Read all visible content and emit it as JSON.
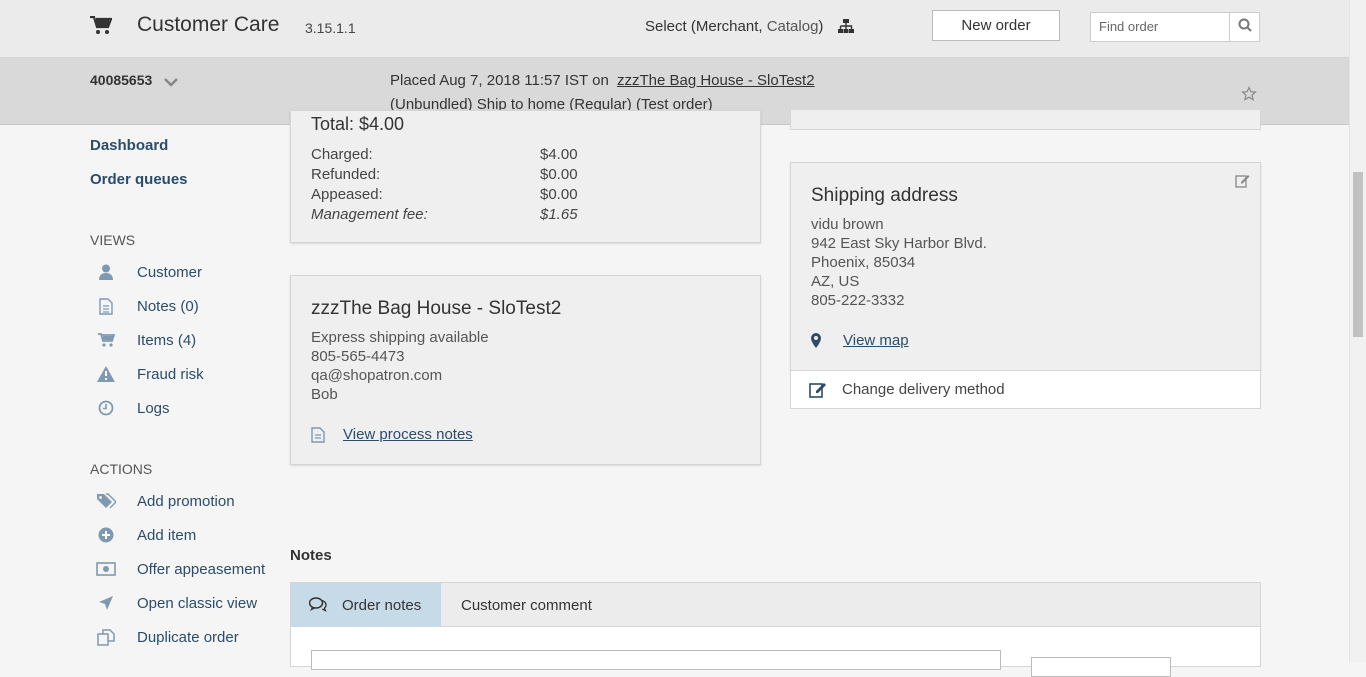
{
  "header": {
    "app_title": "Customer Care",
    "version": "3.15.1.1",
    "select_prefix": "Select (Merchant, ",
    "select_catalog": "Catalog",
    "select_suffix": ")",
    "new_order_label": "New order",
    "find_order_placeholder": "Find order",
    "icons": [
      "cart-icon",
      "hierarchy-icon",
      "search-icon"
    ]
  },
  "order_bar": {
    "order_number": "40085653",
    "placed_text": "Placed Aug 7, 2018 11:57 IST on",
    "merchant_link": "zzzThe Bag House - SloTest2",
    "sub_text": "(Unbundled)  Ship to home (Regular) (Test order)"
  },
  "sidebar": {
    "links": [
      "Dashboard",
      "Order queues"
    ],
    "views_heading": "VIEWS",
    "views": [
      {
        "label": "Customer",
        "icon": "user-icon"
      },
      {
        "label": "Notes (0)",
        "icon": "document-icon"
      },
      {
        "label": "Items (4)",
        "icon": "cart-icon"
      },
      {
        "label": "Fraud risk",
        "icon": "warning-icon"
      },
      {
        "label": "Logs",
        "icon": "clock-icon"
      }
    ],
    "actions_heading": "ACTIONS",
    "actions": [
      {
        "label": "Add promotion",
        "icon": "tags-icon"
      },
      {
        "label": "Add item",
        "icon": "plus-circle-icon"
      },
      {
        "label": "Offer appeasement",
        "icon": "money-icon"
      },
      {
        "label": "Open classic view",
        "icon": "paper-plane-icon"
      },
      {
        "label": "Duplicate order",
        "icon": "copy-icon"
      }
    ]
  },
  "totals": {
    "title": "Total: $4.00",
    "rows": [
      {
        "label": "Charged:",
        "value": "$4.00"
      },
      {
        "label": "Refunded:",
        "value": "$0.00"
      },
      {
        "label": "Appeased:",
        "value": "$0.00"
      },
      {
        "label": "Management fee:",
        "value": "$1.65"
      }
    ]
  },
  "merchant": {
    "name": "zzzThe Bag House - SloTest2",
    "lines": [
      "Express shipping available",
      "805-565-4473",
      "qa@shopatron.com",
      "Bob"
    ],
    "process_notes_link": "View process notes"
  },
  "shipping": {
    "title": "Shipping address",
    "lines": [
      "vidu brown",
      "942 East Sky Harbor Blvd.",
      "Phoenix, 85034",
      "AZ, US",
      "805-222-3332"
    ],
    "map_link": "View map",
    "change_delivery": "Change delivery method"
  },
  "notes": {
    "heading": "Notes",
    "tabs": [
      "Order notes",
      "Customer comment"
    ]
  }
}
